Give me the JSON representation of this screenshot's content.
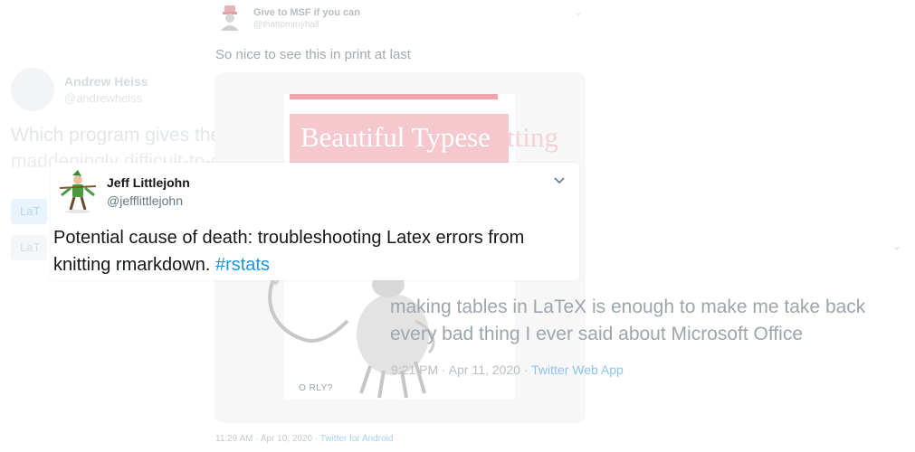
{
  "tweets": {
    "tom": {
      "name": "Give to MSF if you can",
      "handle": "@thattommyhall",
      "text": "So nice to see this in print at last",
      "book": {
        "title": "Beautiful Typesetting",
        "title_visible": "Beautiful Typese",
        "title_overflow": "tting",
        "publisher": "O RLY?"
      },
      "meta": {
        "time": "11:29 AM · Apr 10, 2020 · ",
        "source": "Twitter for Android"
      }
    },
    "andrew": {
      "name": "Andrew Heiss",
      "handle": "@andrewheiss",
      "text_line1": "Which program gives the most c",
      "text_line2": "maddeningly difficult-to-decipher logs and messages?",
      "poll_options": [
        "LaT",
        "LaT"
      ]
    },
    "right": {
      "text_line1": "making tables in LaTeX is enough to make me take back",
      "text_line2": "every bad thing I ever said about Microsoft Office",
      "meta": {
        "time": "9:21 PM · Apr 11, 2020 · ",
        "source": "Twitter Web App"
      }
    },
    "jeff": {
      "name": "Jeff Littlejohn",
      "handle": "@jefflittlejohn",
      "text": "Potential cause of death: troubleshooting Latex errors from knitting rmarkdown. ",
      "hashtag": "#rstats"
    }
  },
  "icons": {
    "chevron": "chevron-down-icon"
  },
  "colors": {
    "link": "#1b95e0",
    "text": "#14171a",
    "secondary": "#657786",
    "book_pink": "#f5c8ce"
  }
}
